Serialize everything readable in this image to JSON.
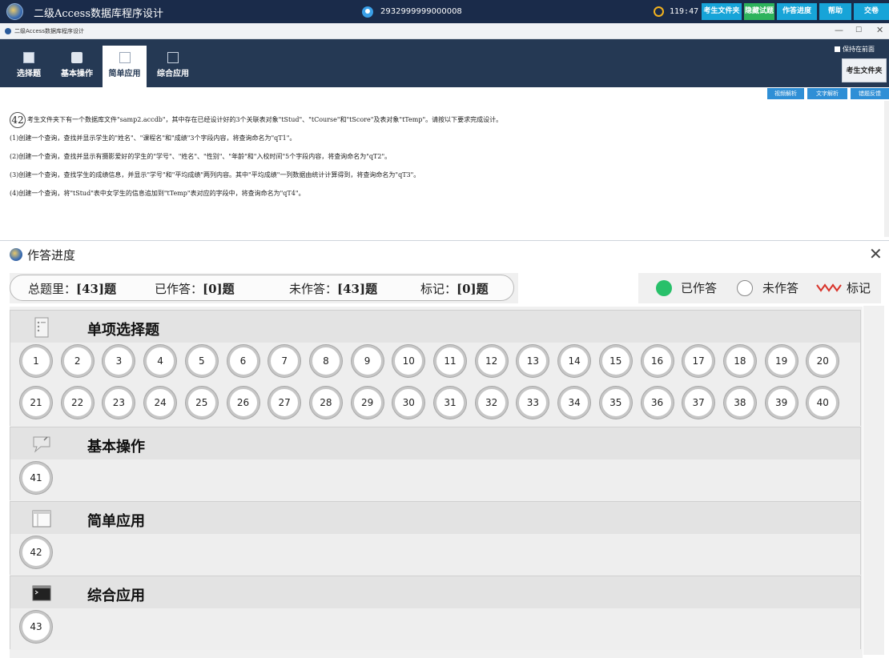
{
  "topbar": {
    "app_title": "二级Access数据库程序设计",
    "user_id": "2932999999000008",
    "timer": "119:47",
    "buttons": [
      "考生文件夹",
      "隐藏试题",
      "作答进度",
      "帮助",
      "交卷"
    ]
  },
  "window": {
    "title": "二级Access数据库程序设计",
    "controls": [
      "—",
      "☐",
      "✕"
    ]
  },
  "tabs": [
    {
      "label": "选择题",
      "icon": "document-icon",
      "active": false
    },
    {
      "label": "基本操作",
      "icon": "chat-icon",
      "active": false
    },
    {
      "label": "简单应用",
      "icon": "window-icon",
      "active": true
    },
    {
      "label": "综合应用",
      "icon": "terminal-icon",
      "active": false
    }
  ],
  "header": {
    "keep_front": "保持在前面",
    "folder_button": "考生文件夹"
  },
  "sub_buttons": [
    "视频解析",
    "文字解析",
    "错题反馈"
  ],
  "question": {
    "number": "42",
    "intro": "考生文件夹下有一个数据库文件\"samp2.accdb\"，其中存在已经设计好的3个关联表对象\"tStud\"、\"tCourse\"和\"tScore\"及表对象\"tTemp\"。请按以下要求完成设计。",
    "items": [
      "(1)创建一个查询，查找并显示学生的\"姓名\"、\"课程名\"和\"成绩\"3个字段内容，将查询命名为\"qT1\"。",
      "(2)创建一个查询，查找并显示有摄影爱好的学生的\"学号\"、\"姓名\"、\"性别\"、\"年龄\"和\"入校时间\"5个字段内容，将查询命名为\"qT2\"。",
      "(3)创建一个查询，查找学生的成绩信息，并显示\"学号\"和\"平均成绩\"两列内容。其中\"平均成绩\"一列数据由统计计算得到，将查询命名为\"qT3\"。",
      "(4)创建一个查询，将\"tStud\"表中女学生的信息追加到\"tTemp\"表对应的字段中，将查询命名为\"qT4\"。"
    ]
  },
  "progress": {
    "title": "作答进度",
    "summary": {
      "total_label": "总题里：",
      "total_value": "[43]题",
      "answered_label": "已作答：",
      "answered_value": "[0]题",
      "unanswered_label": "未作答：",
      "unanswered_value": "[43]题",
      "marked_label": "标记：",
      "marked_value": "[0]题"
    },
    "legend": {
      "answered": "已作答",
      "unanswered": "未作答",
      "marked": "标记"
    },
    "sections": [
      {
        "title": "单项选择题",
        "icon": "document-icon",
        "questions": [
          "1",
          "2",
          "3",
          "4",
          "5",
          "6",
          "7",
          "8",
          "9",
          "10",
          "11",
          "12",
          "13",
          "14",
          "15",
          "16",
          "17",
          "18",
          "19",
          "20",
          "21",
          "22",
          "23",
          "24",
          "25",
          "26",
          "27",
          "28",
          "29",
          "30",
          "31",
          "32",
          "33",
          "34",
          "35",
          "36",
          "37",
          "38",
          "39",
          "40"
        ]
      },
      {
        "title": "基本操作",
        "icon": "chat-icon",
        "questions": [
          "41"
        ]
      },
      {
        "title": "简单应用",
        "icon": "window-icon",
        "questions": [
          "42"
        ]
      },
      {
        "title": "综合应用",
        "icon": "terminal-icon",
        "questions": [
          "43"
        ]
      }
    ]
  },
  "colors": {
    "navy": "#253954",
    "topbar": "#1a2b4a",
    "button_blue": "#17a4d8",
    "button_green": "#2db35c",
    "answered_green": "#28c06a",
    "mark_red": "#d9342b"
  }
}
